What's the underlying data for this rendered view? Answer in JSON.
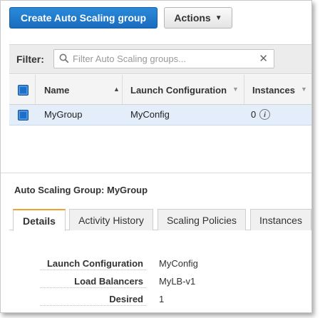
{
  "toolbar": {
    "create_label": "Create Auto Scaling group",
    "actions_label": "Actions"
  },
  "filter": {
    "label": "Filter:",
    "placeholder": "Filter Auto Scaling groups..."
  },
  "table": {
    "columns": [
      "Name",
      "Launch Configuration",
      "Instances"
    ],
    "rows": [
      {
        "name": "MyGroup",
        "launch_configuration": "MyConfig",
        "instances": "0",
        "selected": true
      }
    ]
  },
  "details": {
    "title": "Auto Scaling Group: MyGroup",
    "tabs": [
      "Details",
      "Activity History",
      "Scaling Policies",
      "Instances"
    ],
    "active_tab": "Details",
    "fields": [
      {
        "key": "Launch Configuration",
        "value": "MyConfig"
      },
      {
        "key": "Load Balancers",
        "value": "MyLB-v1"
      },
      {
        "key": "Desired",
        "value": "1"
      }
    ]
  },
  "colors": {
    "primary": "#1a6cc0",
    "selected_row": "#e4eefa",
    "active_tab_accent": "#f0a22e"
  }
}
